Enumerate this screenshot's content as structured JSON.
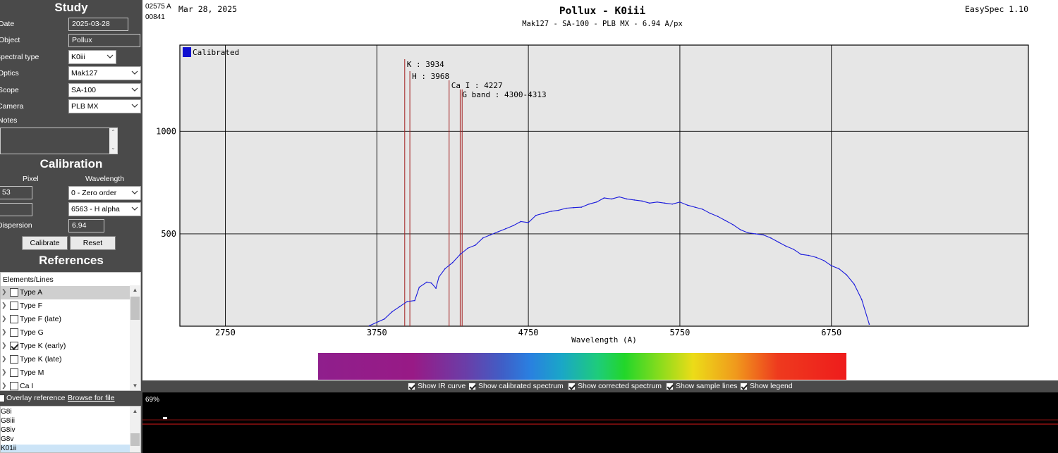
{
  "study": {
    "title": "Study",
    "date_label": "Date",
    "date_value": "2025-03-28",
    "object_label": "Object",
    "object_value": "Pollux",
    "spectral_type_label": "Spectral type",
    "spectral_type_value": "K0iii",
    "optics_label": "Optics",
    "optics_value": "Mak127",
    "scope_label": "Scope",
    "scope_value": "SA-100",
    "camera_label": "Camera",
    "camera_value": "PLB MX",
    "notes_label": "Notes",
    "notes_value": ""
  },
  "calibration": {
    "title": "Calibration",
    "pixel_header": "Pixel",
    "wavelength_header": "Wavelength",
    "pixel1": "53",
    "pixel2": "",
    "wavelength1": "0 - Zero order",
    "wavelength2": "6563 - H alpha",
    "dispersion_label": "Dispersion",
    "dispersion_value": "6.94",
    "calibrate_label": "Calibrate",
    "reset_label": "Reset"
  },
  "references": {
    "title": "References",
    "header": "Elements/Lines",
    "items": [
      {
        "label": "Type A",
        "checked": false,
        "selected": true
      },
      {
        "label": "Type F",
        "checked": false,
        "selected": false
      },
      {
        "label": "Type F (late)",
        "checked": false,
        "selected": false
      },
      {
        "label": "Type G",
        "checked": false,
        "selected": false
      },
      {
        "label": "Type K (early)",
        "checked": true,
        "selected": false
      },
      {
        "label": "Type K (late)",
        "checked": false,
        "selected": false
      },
      {
        "label": "Type M",
        "checked": false,
        "selected": false
      },
      {
        "label": "Ca I",
        "checked": false,
        "selected": false
      }
    ],
    "overlay_label": "Overlay reference",
    "browse_label": "Browse for file",
    "spectra": [
      "G8i",
      "G8iii",
      "G8iv",
      "G8v",
      "K01ii"
    ],
    "selected_spectrum": "K01ii"
  },
  "header": {
    "counter1": "02575 A",
    "counter2": "00841",
    "date": "Mar 28, 2025",
    "title": "Pollux - K0iii",
    "subtitle": "Mak127 - SA-100 - PLB MX - 6.94 A/px",
    "app": "EasySpec 1.10"
  },
  "chart_data": {
    "type": "line",
    "title": "Pollux - K0iii",
    "subtitle": "Mak127 - SA-100 - PLB MX - 6.94 A/px",
    "xlabel": "Wavelength (A)",
    "ylabel": "",
    "xlim": [
      2450,
      8050
    ],
    "ylim": [
      50,
      1420
    ],
    "xticks": [
      2750,
      3750,
      4750,
      5750,
      6750
    ],
    "yticks": [
      500,
      1000
    ],
    "grid": true,
    "legend": {
      "position": "top-left",
      "entries": [
        "Calibrated"
      ]
    },
    "series": [
      {
        "name": "Calibrated",
        "color": "#1a1adc",
        "x": [
          3700,
          3800,
          3850,
          3900,
          3950,
          4000,
          4030,
          4080,
          4110,
          4140,
          4160,
          4200,
          4250,
          4300,
          4350,
          4400,
          4450,
          4500,
          4550,
          4600,
          4650,
          4700,
          4750,
          4800,
          4850,
          4900,
          4950,
          5000,
          5050,
          5100,
          5150,
          5200,
          5250,
          5300,
          5350,
          5400,
          5450,
          5500,
          5550,
          5600,
          5650,
          5700,
          5750,
          5800,
          5850,
          5900,
          5950,
          6000,
          6050,
          6100,
          6150,
          6200,
          6250,
          6300,
          6350,
          6400,
          6450,
          6500,
          6550,
          6600,
          6650,
          6700,
          6750,
          6800,
          6850,
          6900,
          6950,
          7000
        ],
        "y": [
          52,
          85,
          120,
          145,
          170,
          175,
          240,
          265,
          260,
          235,
          290,
          330,
          360,
          400,
          430,
          445,
          480,
          495,
          510,
          525,
          540,
          560,
          555,
          590,
          600,
          610,
          615,
          625,
          628,
          630,
          645,
          655,
          675,
          670,
          680,
          670,
          665,
          660,
          650,
          655,
          650,
          645,
          655,
          640,
          630,
          620,
          600,
          585,
          565,
          545,
          520,
          505,
          500,
          495,
          480,
          460,
          440,
          425,
          400,
          395,
          385,
          370,
          345,
          330,
          300,
          255,
          180,
          60
        ]
      }
    ],
    "annotations": [
      {
        "label": "K : 3934",
        "x": 3934
      },
      {
        "label": "H : 3968",
        "x": 3968
      },
      {
        "label": "Ca I : 4227",
        "x": 4227
      },
      {
        "label": "G band : 4300-4313",
        "x": 4300,
        "x2": 4313
      }
    ]
  },
  "options": [
    {
      "label": "Show IR curve",
      "checked": true
    },
    {
      "label": "Show calibrated spectrum",
      "checked": true
    },
    {
      "label": "Show corrected spectrum",
      "checked": true
    },
    {
      "label": "Show sample lines",
      "checked": true
    },
    {
      "label": "Show legend",
      "checked": true
    }
  ],
  "camera": {
    "zoom_label": "69%"
  },
  "colors": {
    "panel_bg": "#4a4a4a",
    "plot_bg": "#e6e6e6",
    "spectrum_line": "#1a1adc",
    "marker_line": "#a31f1f",
    "legend_swatch": "#1010d0"
  }
}
